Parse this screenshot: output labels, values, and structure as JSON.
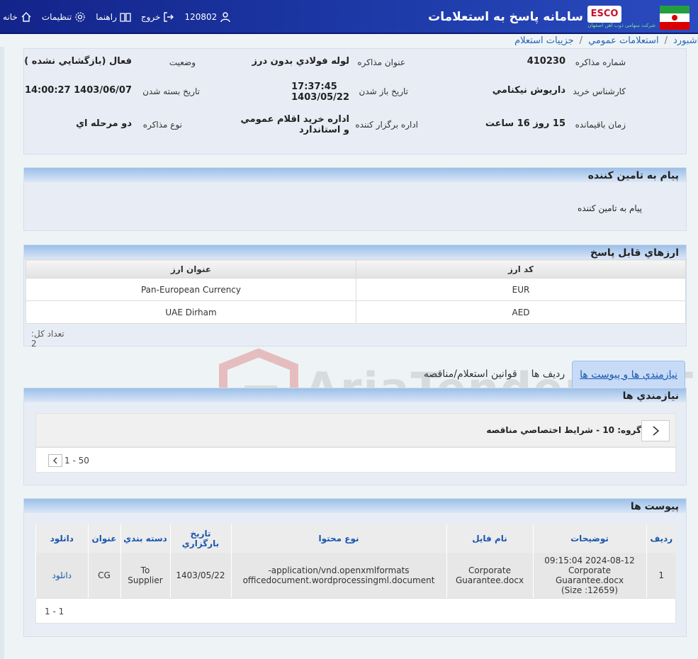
{
  "header": {
    "app_title": "سامانه پاسخ به استعلامات",
    "esco_logo": "ESCO",
    "company_subtitle": "شرکت سهامی ذوب آهن اصفهان",
    "nav": {
      "home": "خانه",
      "settings": "تنظیمات",
      "help": "راهنما",
      "logout": "خروج"
    },
    "user_id": "120802"
  },
  "breadcrumb": {
    "items": [
      "داشبورد",
      "استعلامات عمومي",
      "جزييات استعلام"
    ]
  },
  "info": {
    "labels": {
      "number": "شماره مذاکره",
      "title": "عنوان مذاکره",
      "status": "وضعيت",
      "expert": "کارشناس خريد",
      "open_date": "تاريخ باز شدن",
      "close_date": "تاريخ بسته شدن",
      "remaining": "زمان باقيمانده",
      "organizer": "اداره برگزار کننده",
      "type": "نوع مذاکره"
    },
    "values": {
      "number": "410230",
      "title": "لوله فولادي بدون درز",
      "status": "فعال (بازگشايي نشده )",
      "expert": "داريوش نيکنامي",
      "open_time": "17:37:45",
      "open_date": "1403/05/22",
      "close_date": "1403/06/07 14:00:27",
      "remaining": "15 روز 16 ساعت",
      "organizer_line1": "اداره خريد اقلام عمومي",
      "organizer_line2": "و استاندارد",
      "type": "دو مرحله اي"
    }
  },
  "message_panel": {
    "title": "پيام به تامين کننده",
    "text": "پيام به تامين کننده"
  },
  "currencies": {
    "title": "ارزهاي قابل پاسخ",
    "columns": [
      "کد ارز",
      "عنوان ارز"
    ],
    "rows": [
      {
        "code": "EUR",
        "name": "Pan-European Currency"
      },
      {
        "code": "AED",
        "name": "UAE Dirham"
      }
    ],
    "total": "تعداد کل: 2"
  },
  "tabs": [
    {
      "label": "نيازمندي ها و پيوست ها",
      "active": true
    },
    {
      "label": "رديف ها",
      "active": false
    },
    {
      "label": "قوانين استعلام/مناقصه",
      "active": false
    }
  ],
  "requirements": {
    "title": "نيازمندي ها",
    "group_label": "گروه: 10 - شرايط اختصاصي مناقصه",
    "pager": "1 - 50"
  },
  "attachments": {
    "title": "پيوست ها",
    "columns": [
      "رديف",
      "توضيحات",
      "نام فايل",
      "نوع محتوا",
      "تاريخ بارگزاري",
      "دسته بندي",
      "عنوان",
      "دانلود"
    ],
    "rows": [
      {
        "row": "1",
        "desc_line1": "2024-08-12 09:15:04",
        "desc_line2": "Corporate Guarantee.docx",
        "desc_line3": "(Size :12659)",
        "file_line1": "Corporate",
        "file_line2": "Guarantee.docx",
        "type_line1": "application/vnd.openxmlformats-",
        "type_line2": "officedocument.wordprocessingml.document",
        "date": "1403/05/22",
        "cat_line1": "To",
        "cat_line2": "Supplier",
        "title": "CG",
        "download": "دانلود"
      }
    ],
    "pager": "1 - 1"
  },
  "watermark": "AriaTender.neT",
  "colors": {
    "header": "#1d3aa7",
    "accent": "#1a56b0",
    "panel_header": "#9bbfe9"
  }
}
